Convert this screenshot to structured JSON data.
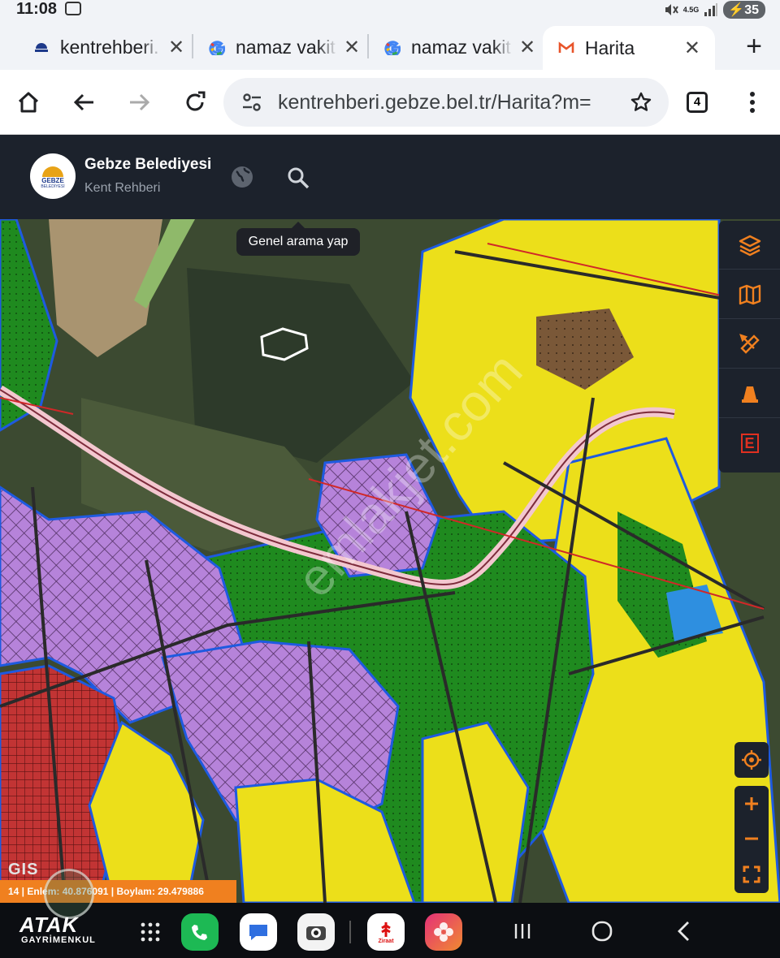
{
  "status_bar": {
    "time": "11:08",
    "network": "4.5G",
    "battery": "35"
  },
  "tabs": [
    {
      "title": "kentrehberi.",
      "favicon": "gebze-favicon",
      "active": false
    },
    {
      "title": "namaz vakit",
      "favicon": "google-g-icon",
      "active": false
    },
    {
      "title": "namaz vakit",
      "favicon": "google-g-icon",
      "active": false
    },
    {
      "title": "Harita",
      "favicon": "gmail-m-icon",
      "active": true
    }
  ],
  "toolbar": {
    "url": "kentrehberi.gebze.bel.tr/Harita?m=",
    "tab_count": "4"
  },
  "app_header": {
    "logo_line1": "GEBZE",
    "logo_line2": "BELEDİYESİ",
    "title": "Gebze Belediyesi",
    "subtitle": "Kent Rehberi"
  },
  "tooltip": "Genel arama yap",
  "map": {
    "coord_text": "14 | Enlem: 40.876091 | Boylam: 29.479886",
    "gis_label": "GIS",
    "watermark": "emlakjet.com"
  },
  "right_tools": [
    "layers-icon",
    "basemap-icon",
    "measure-icon",
    "cone-icon",
    "e-tool-icon"
  ],
  "map_controls": [
    "locate-icon",
    "zoom-in-icon",
    "zoom-out-icon",
    "fullscreen-icon"
  ],
  "bottom_bar": {
    "overlay_logo": {
      "name": "ATAK",
      "sub": "GAYRİMENKUL"
    },
    "apps": [
      "app-grid-icon",
      "phone-icon",
      "messages-icon",
      "camera-icon",
      "ziraat-app-icon",
      "gallery-icon"
    ],
    "app_label_ziraat": "Ziraat",
    "nav": [
      "recents-button",
      "home-button",
      "back-button"
    ]
  },
  "colors": {
    "accent": "#f0801f",
    "header_bg": "#1c222c",
    "zone_yellow": "#f2e51e",
    "zone_green": "#1f7a1f",
    "zone_purple": "#b07ed8",
    "zone_blue": "#2e8fe0",
    "zone_red": "#d63a3a"
  }
}
